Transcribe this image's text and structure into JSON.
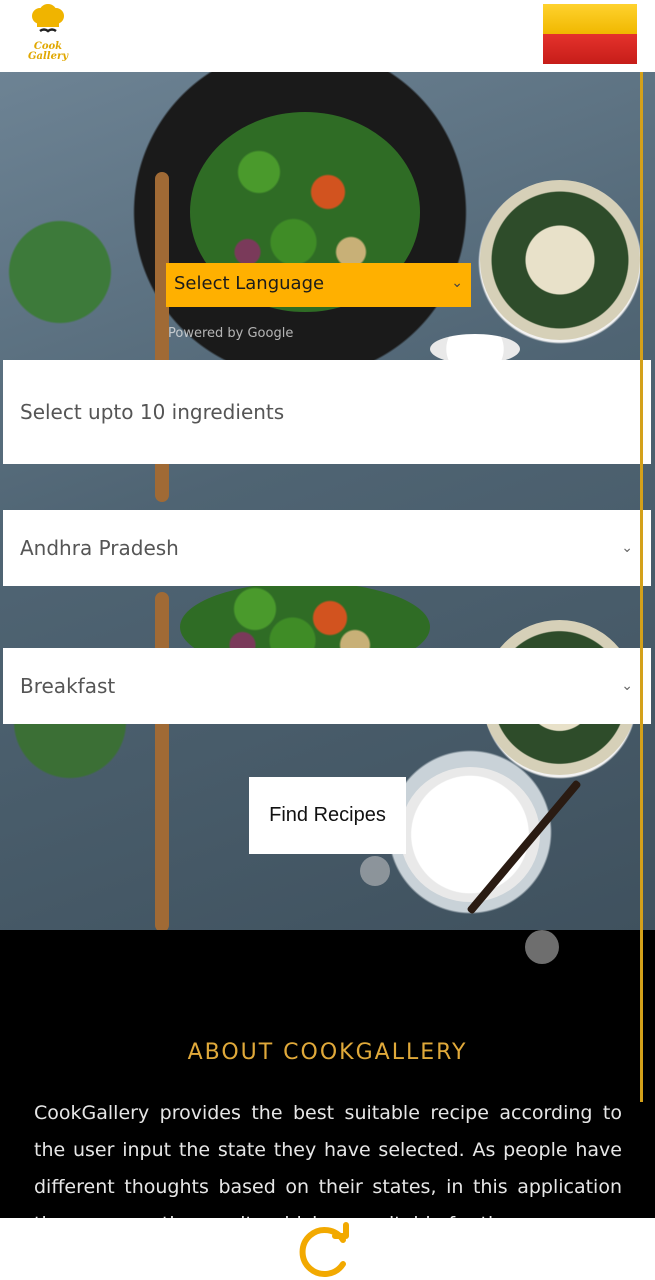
{
  "header": {
    "logo_text_line1": "Cook",
    "logo_text_line2": "Gallery",
    "flag_icon": "karnataka-flag-icon"
  },
  "language": {
    "label": "Select Language",
    "powered_by": "Powered by Google"
  },
  "ingredients": {
    "placeholder": "Select upto 10 ingredients"
  },
  "state_select": {
    "selected": "Andhra Pradesh"
  },
  "meal_select": {
    "selected": "Breakfast"
  },
  "find_button": {
    "label": "Find Recipes"
  },
  "about": {
    "title": "ABOUT COOKGALLERY",
    "text": "CookGallery provides the best suitable recipe according to the user input the state they have selected. As people have different thoughts based on their states, in this application they can see the results which are suitable for them."
  },
  "colors": {
    "accent": "#ffb000",
    "about_title": "#e0a93a",
    "background": "#000000"
  },
  "icons": {
    "refresh": "refresh-icon",
    "chef": "chef-hat-icon"
  }
}
